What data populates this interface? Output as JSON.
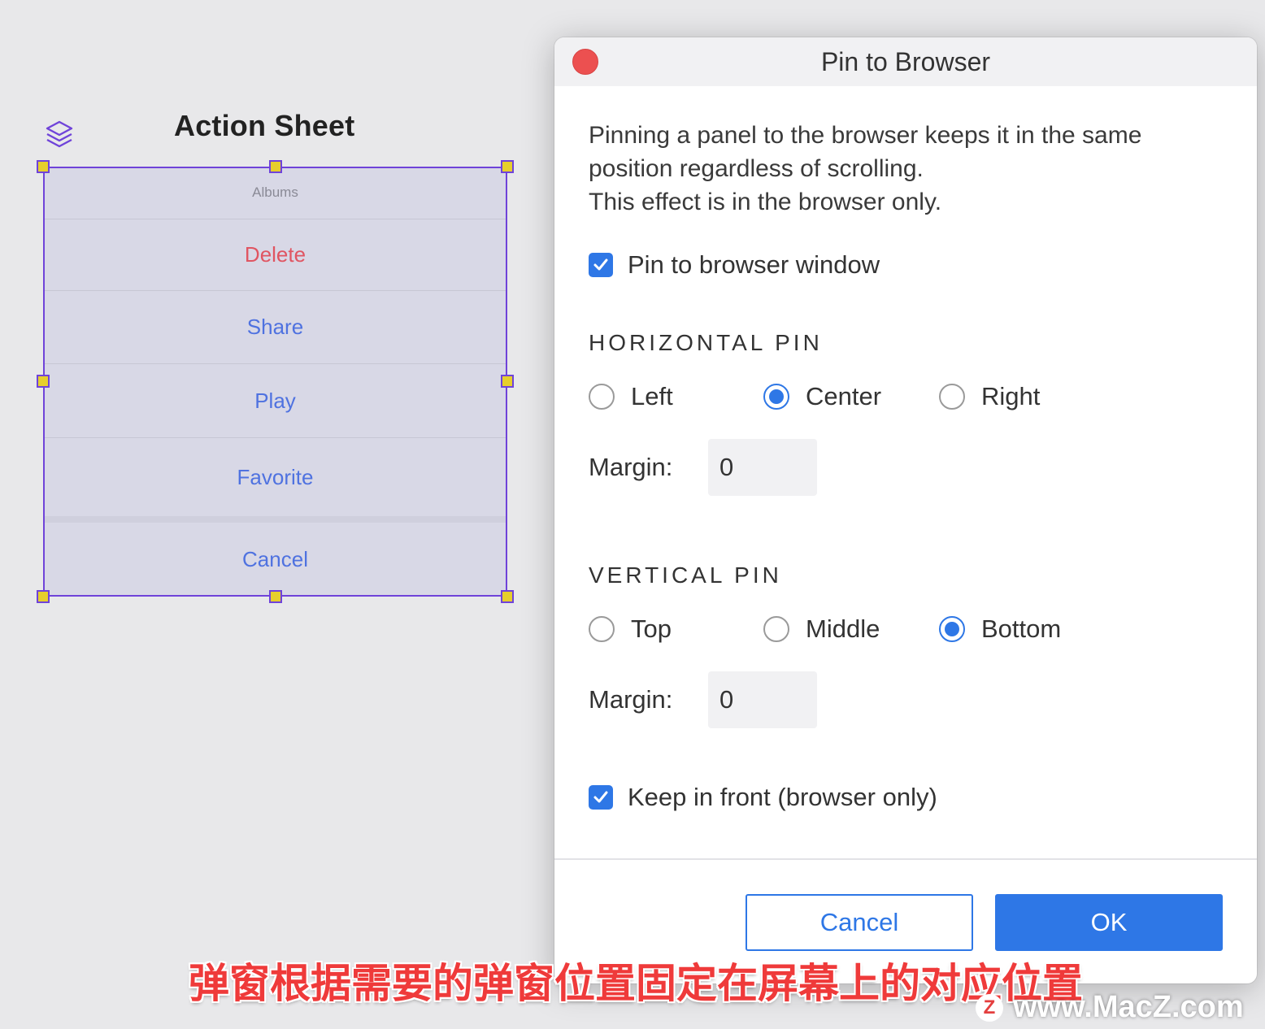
{
  "canvas": {
    "sheet_title": "Action Sheet",
    "layers_icon": "layers-icon",
    "action_sheet": {
      "header": "Albums",
      "items": [
        {
          "label": "Delete",
          "style": "destructive"
        },
        {
          "label": "Share",
          "style": "default"
        },
        {
          "label": "Play",
          "style": "default"
        },
        {
          "label": "Favorite",
          "style": "default"
        }
      ],
      "cancel": "Cancel"
    },
    "selection_color": "#6f43d9",
    "handle_color": "#e6cf2c"
  },
  "dialog": {
    "title": "Pin to Browser",
    "close_icon": "close-icon",
    "description": [
      "Pinning a panel to the browser keeps it in the same",
      "position regardless of scrolling.",
      "This effect is in the browser only."
    ],
    "pin_to_window": {
      "label": "Pin to browser window",
      "checked": true
    },
    "horizontal": {
      "title": "HORIZONTAL PIN",
      "options": [
        "Left",
        "Center",
        "Right"
      ],
      "selected": "Center",
      "margin_label": "Margin:",
      "margin_value": "0"
    },
    "vertical": {
      "title": "VERTICAL PIN",
      "options": [
        "Top",
        "Middle",
        "Bottom"
      ],
      "selected": "Bottom",
      "margin_label": "Margin:",
      "margin_value": "0"
    },
    "keep_in_front": {
      "label": "Keep in front (browser only)",
      "checked": true
    },
    "buttons": {
      "cancel": "Cancel",
      "ok": "OK"
    },
    "accent_color": "#2e77e6",
    "close_color": "#ec5050"
  },
  "overlay": {
    "subtitle": "弹窗根据需要的弹窗位置固定在屏幕上的对应位置",
    "watermark_logo": "Z",
    "watermark": "www.MacZ.com"
  }
}
